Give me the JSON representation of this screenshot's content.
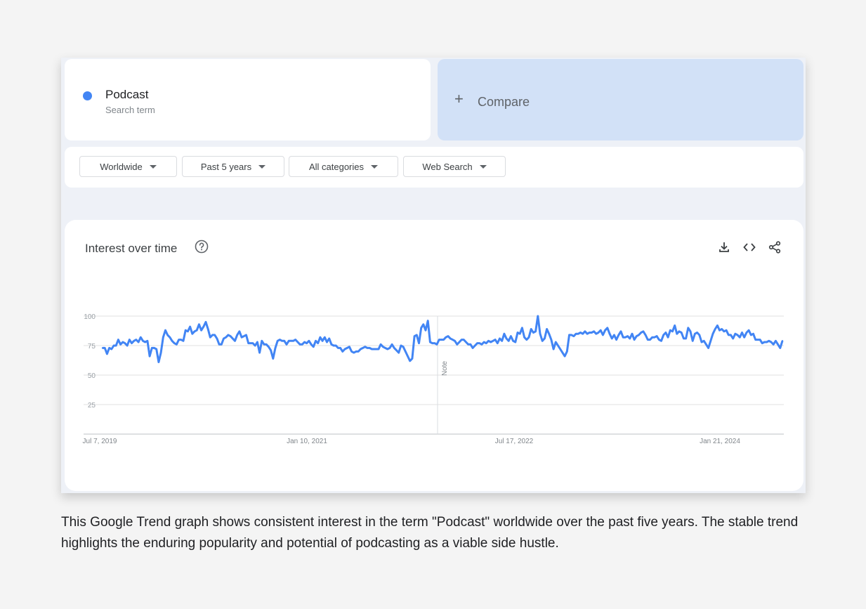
{
  "search_term": {
    "name": "Podcast",
    "subtitle": "Search term",
    "color": "#4285f4"
  },
  "compare": {
    "label": "Compare",
    "icon": "plus-icon"
  },
  "filters": {
    "region": "Worldwide",
    "period": "Past 5 years",
    "category": "All categories",
    "search_type": "Web Search"
  },
  "chart_card": {
    "title": "Interest over time",
    "help_icon": "help-icon",
    "tools": [
      "download-icon",
      "embed-icon",
      "share-icon"
    ]
  },
  "chart_data": {
    "type": "line",
    "y_ticks": [
      100,
      75,
      50,
      25
    ],
    "ylim": [
      0,
      100
    ],
    "x_tick_labels": [
      "Jul 7, 2019",
      "Jan 10, 2021",
      "Jul 17, 2022",
      "Jan 21, 2024"
    ],
    "annotation": "Note",
    "grid": true,
    "series": [
      {
        "color": "#4285f4",
        "values": [
          73,
          73,
          68,
          73,
          72,
          75,
          75,
          80,
          76,
          78,
          77,
          75,
          80,
          77,
          79,
          80,
          78,
          82,
          79,
          78,
          79,
          66,
          73,
          73,
          72,
          61,
          69,
          82,
          88,
          84,
          82,
          79,
          77,
          76,
          80,
          80,
          79,
          88,
          87,
          91,
          85,
          87,
          88,
          93,
          88,
          91,
          95,
          89,
          82,
          84,
          84,
          81,
          76,
          76,
          81,
          82,
          84,
          83,
          81,
          79,
          84,
          87,
          82,
          83,
          84,
          77,
          77,
          77,
          75,
          78,
          69,
          79,
          76,
          76,
          74,
          71,
          64,
          73,
          79,
          80,
          79,
          79,
          76,
          79,
          79,
          79,
          80,
          78,
          76,
          76,
          78,
          77,
          79,
          76,
          74,
          79,
          77,
          82,
          79,
          82,
          78,
          81,
          76,
          75,
          75,
          73,
          73,
          70,
          72,
          73,
          74,
          70,
          69,
          70,
          70,
          72,
          73,
          74,
          73,
          73,
          72,
          72,
          72,
          72,
          76,
          74,
          73,
          72,
          73,
          76,
          73,
          71,
          69,
          75,
          74,
          70,
          66,
          62,
          64,
          83,
          84,
          77,
          90,
          93,
          88,
          96,
          78,
          77,
          77,
          76,
          80,
          80,
          80,
          82,
          83,
          81,
          80,
          79,
          76,
          78,
          80,
          80,
          78,
          76,
          76,
          73,
          75,
          77,
          77,
          76,
          78,
          77,
          79,
          78,
          79,
          80,
          77,
          81,
          79,
          85,
          81,
          79,
          83,
          79,
          78,
          86,
          85,
          90,
          82,
          80,
          82,
          89,
          86,
          87,
          100,
          85,
          79,
          81,
          89,
          85,
          80,
          72,
          78,
          75,
          72,
          69,
          66,
          70,
          84,
          84,
          83,
          85,
          85,
          86,
          85,
          87,
          85,
          86,
          86,
          87,
          85,
          86,
          88,
          84,
          88,
          90,
          85,
          81,
          84,
          80,
          84,
          87,
          82,
          82,
          83,
          81,
          85,
          80,
          83,
          84,
          86,
          87,
          84,
          80,
          80,
          82,
          82,
          83,
          80,
          79,
          84,
          86,
          82,
          88,
          87,
          92,
          85,
          87,
          86,
          81,
          81,
          90,
          87,
          79,
          85,
          86,
          84,
          78,
          79,
          76,
          73,
          79,
          85,
          89,
          92,
          88,
          89,
          87,
          88,
          84,
          84,
          81,
          85,
          84,
          82,
          86,
          82,
          86,
          88,
          84,
          85,
          80,
          80,
          80,
          77,
          78,
          78,
          79,
          78,
          76,
          79,
          76,
          73,
          79
        ]
      }
    ]
  },
  "caption": "This Google Trend graph shows consistent interest in the term \"Podcast\" worldwide over the past five years. The stable trend highlights the enduring popularity and potential of podcasting as a viable side hustle."
}
